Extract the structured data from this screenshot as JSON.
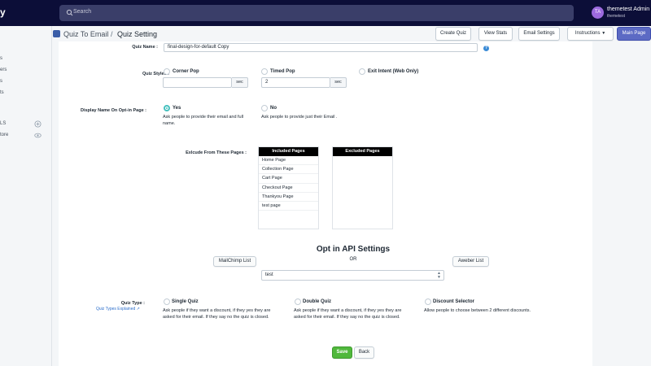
{
  "topbar": {
    "logo_fragment": "y",
    "search_placeholder": "Search",
    "user_initials": "TA",
    "user_name": "themetest Admin",
    "user_store": "themetest"
  },
  "sidebar": {
    "items": [
      "s",
      "ers",
      "s",
      "ts"
    ],
    "section_label": "LS",
    "store_label": "tore"
  },
  "breadcrumb": {
    "parent": "Quiz To Email",
    "separator": "/",
    "current": "Quiz Setting"
  },
  "header_buttons": {
    "create_quiz": "Create Quiz",
    "view_stats": "View Stats",
    "email_settings": "Email Settings",
    "instructions": "Instructions",
    "main_page": "Main Page"
  },
  "form": {
    "quiz_name_label": "Quiz Name :",
    "quiz_name_value": "final-design-for-default Copy",
    "quiz_styles_label": "Quiz Styles :",
    "styles": [
      {
        "label": "Corner Pop",
        "checked": false,
        "input_value": "",
        "unit": "sec"
      },
      {
        "label": "Timed Pop",
        "checked": false,
        "input_value": "2",
        "unit": "sec"
      },
      {
        "label": "Exit Intent (Web Only)",
        "checked": false
      }
    ],
    "display_name_label": "Display Name On Opt-in Page :",
    "display_yes": {
      "label": "Yes",
      "checked": true,
      "help": "Ask people to provide their email and full name."
    },
    "display_no": {
      "label": "No",
      "checked": false,
      "help": "Ask people to provide just their Email ."
    },
    "exclude_label": "Exlcude From These Pages :",
    "included_header": "Included Pages",
    "included_pages": [
      "Home Page",
      "Collection Page",
      "Cart Page",
      "Checkout Page",
      "Thankyou Page",
      "test page"
    ],
    "excluded_header": "Excluded Pages",
    "api_title": "Opt in API Settings",
    "mailchimp_button": "MailChimp List",
    "or_text": "OR",
    "aweber_button": "Aweber List",
    "list_select_value": "test",
    "quiz_type_label": "Quiz Type :",
    "quiz_types_link": "Quiz Types Explained",
    "quiz_types": [
      {
        "label": "Single Quiz",
        "checked": false,
        "help": "Ask people if they want a discount, if they yes they are asked for their email. If they say no the quiz is closed."
      },
      {
        "label": "Double Quiz",
        "checked": false,
        "help": "Ask people if they want a discount, if they yes they are asked for their email. If they say no the quiz is closed."
      },
      {
        "label": "Discount Selector",
        "checked": false,
        "help": "Allow people to choose between 2 different discounts."
      }
    ],
    "save_button": "Save",
    "back_button": "Back"
  },
  "colors": {
    "topbar": "#0c0e38",
    "search": "#3a3e69",
    "primary": "#5c6ac4",
    "save": "#50b83c",
    "radio_checked": "#47c1bf",
    "avatar": "#9c6ade"
  }
}
